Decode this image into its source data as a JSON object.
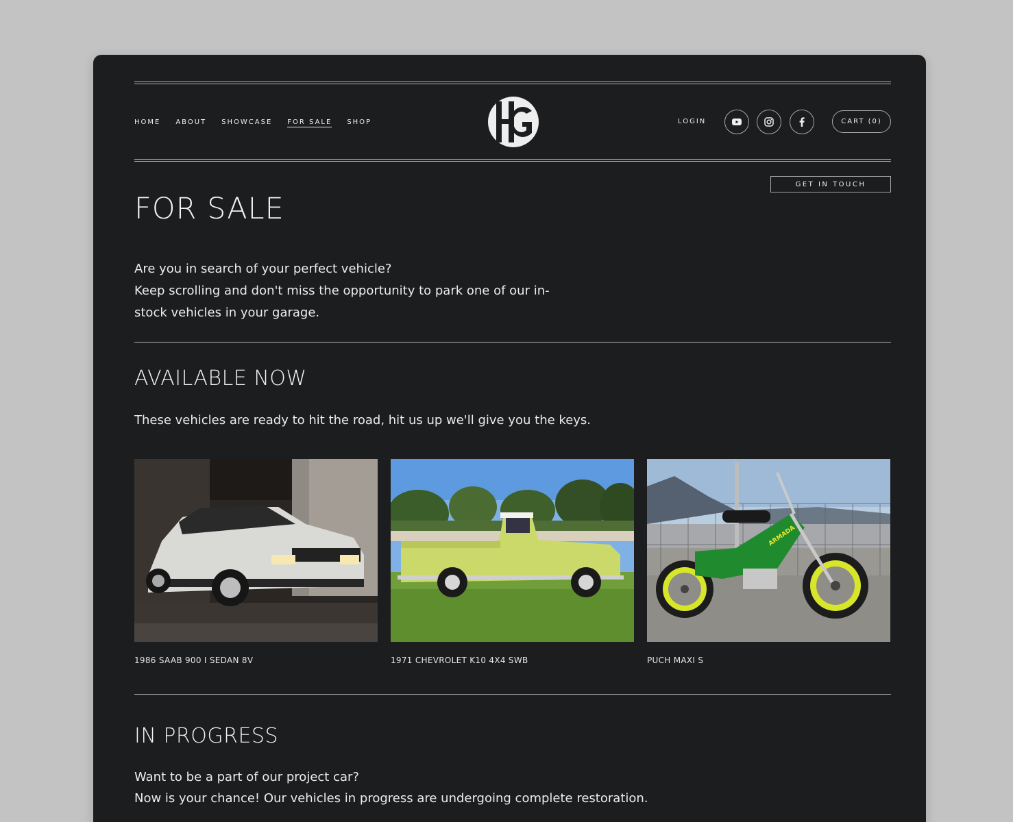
{
  "nav": {
    "items": [
      {
        "label": "HOME",
        "active": false
      },
      {
        "label": "ABOUT",
        "active": false
      },
      {
        "label": "SHOWCASE",
        "active": false
      },
      {
        "label": "FOR SALE",
        "active": true
      },
      {
        "label": "SHOP",
        "active": false
      }
    ],
    "logo_text": "HG",
    "login_label": "LOGIN",
    "social": [
      "youtube-icon",
      "instagram-icon",
      "facebook-icon"
    ],
    "cart_label": "CART (0)"
  },
  "cta": {
    "label": "GET IN TOUCH"
  },
  "page": {
    "title": "FOR SALE",
    "intro": [
      "Are you in search of your perfect vehicle?",
      "Keep scrolling and don't miss the opportunity to park one of our in-stock vehicles in your garage."
    ]
  },
  "available": {
    "heading": "AVAILABLE NOW",
    "text": "These vehicles are ready to hit the road, hit us up we'll give you the keys.",
    "vehicles": [
      {
        "title": "1986 SAAB 900 I SEDAN 8V"
      },
      {
        "title": "1971 CHEVROLET K10 4X4 SWB"
      },
      {
        "title": "PUCH MAXI S"
      }
    ]
  },
  "progress": {
    "heading": "IN PROGRESS",
    "lines": [
      "Want to be a part of our project car?",
      "Now is your chance! Our vehicles in progress are undergoing complete restoration."
    ]
  },
  "colors": {
    "page_bg": "#c3c3c3",
    "site_bg": "#1c1d1f",
    "text": "#f0f0f0",
    "rule": "#b5b5b5"
  }
}
